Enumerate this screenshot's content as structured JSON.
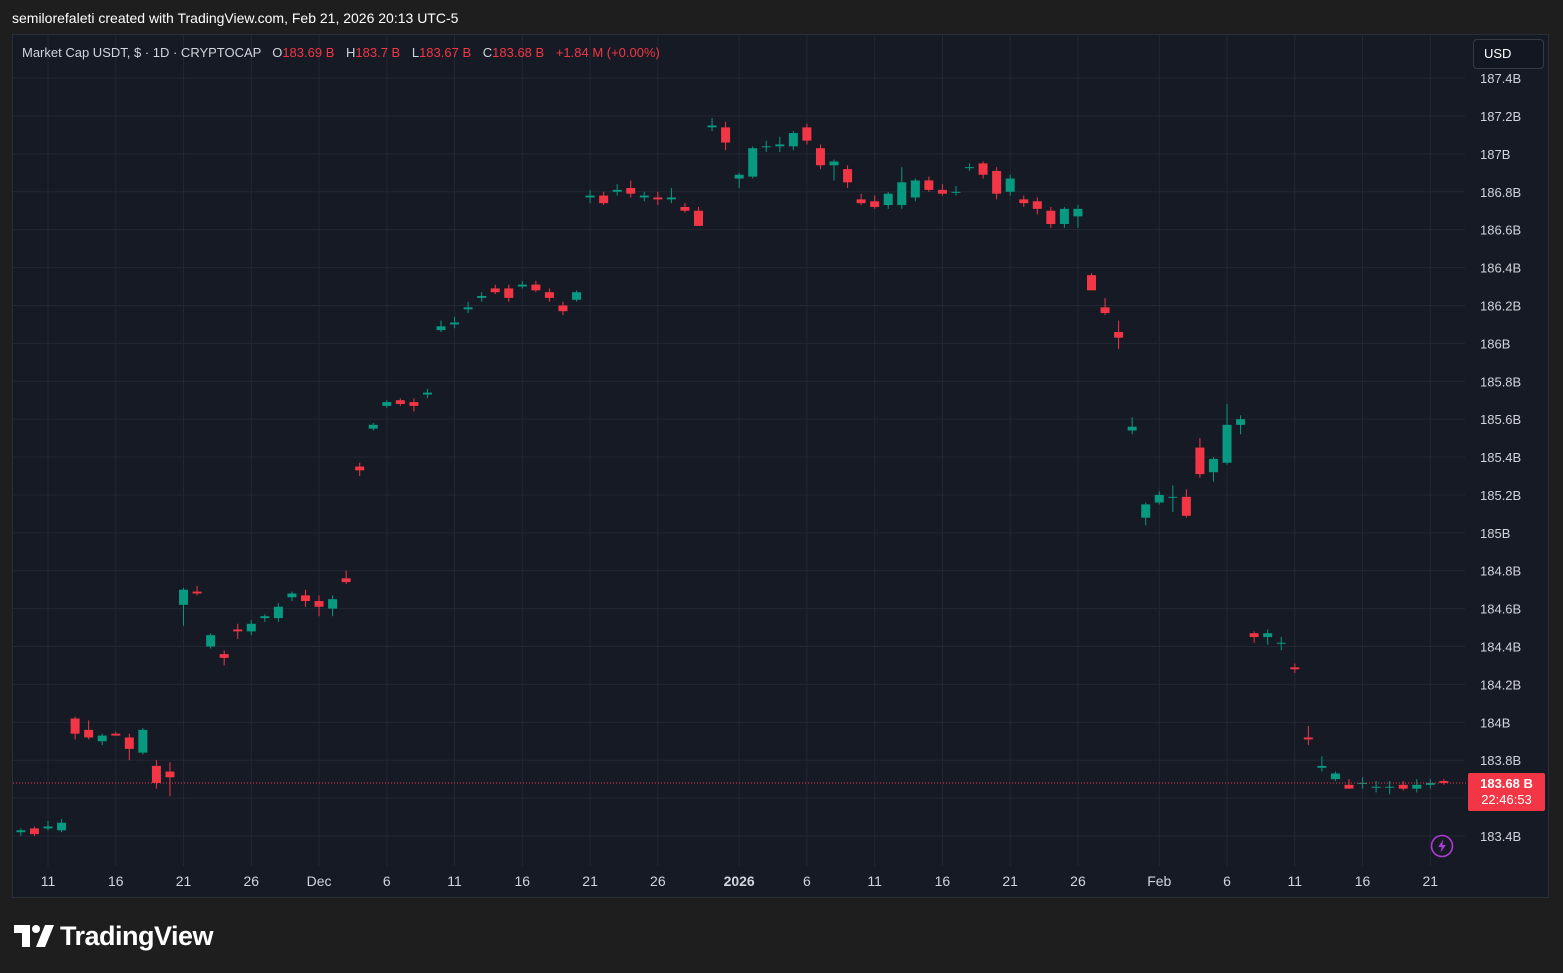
{
  "header": {
    "credit": "semilorefaleti created with TradingView.com, Feb 21, 2026 20:13 UTC-5"
  },
  "legend": {
    "symbol": "Market Cap USDT, $ · 1D · CRYPTOCAP",
    "o_label": "O",
    "o_value": "183.69 B",
    "h_label": "H",
    "h_value": "183.7 B",
    "l_label": "L",
    "l_value": "183.67 B",
    "c_label": "C",
    "c_value": "183.68 B",
    "change": "+1.84 M (+0.00%)"
  },
  "currency": "USD",
  "price_tag": {
    "price": "183.68 B",
    "countdown": "22:46:53"
  },
  "branding": {
    "logo_text": "TradingView"
  },
  "colors": {
    "up": "#089981",
    "down": "#f23645",
    "background": "#161a25",
    "grid": "#232733"
  },
  "chart_data": {
    "type": "candlestick",
    "y_unit": "B",
    "ylim": [
      183.3,
      187.45
    ],
    "y_ticks": [
      183.4,
      183.6,
      183.8,
      184.0,
      184.2,
      184.4,
      184.6,
      184.8,
      185.0,
      185.2,
      185.4,
      185.6,
      185.8,
      186.0,
      186.2,
      186.4,
      186.6,
      186.8,
      187.0,
      187.2,
      187.4
    ],
    "y_tick_labels": [
      "183.4B",
      "",
      "183.8B",
      "184B",
      "184.2B",
      "184.4B",
      "184.6B",
      "184.8B",
      "185B",
      "185.2B",
      "185.4B",
      "185.6B",
      "185.8B",
      "186B",
      "186.2B",
      "186.4B",
      "186.6B",
      "186.8B",
      "187B",
      "187.2B",
      "187.4B"
    ],
    "x_ticks": [
      {
        "date": "2025-11-11",
        "label": "11",
        "bold": false
      },
      {
        "date": "2025-11-16",
        "label": "16",
        "bold": false
      },
      {
        "date": "2025-11-21",
        "label": "21",
        "bold": false
      },
      {
        "date": "2025-11-26",
        "label": "26",
        "bold": false
      },
      {
        "date": "2025-12-01",
        "label": "Dec",
        "bold": false
      },
      {
        "date": "2025-12-06",
        "label": "6",
        "bold": false
      },
      {
        "date": "2025-12-11",
        "label": "11",
        "bold": false
      },
      {
        "date": "2025-12-16",
        "label": "16",
        "bold": false
      },
      {
        "date": "2025-12-21",
        "label": "21",
        "bold": false
      },
      {
        "date": "2025-12-26",
        "label": "26",
        "bold": false
      },
      {
        "date": "2026-01-01",
        "label": "2026",
        "bold": true
      },
      {
        "date": "2026-01-06",
        "label": "6",
        "bold": false
      },
      {
        "date": "2026-01-11",
        "label": "11",
        "bold": false
      },
      {
        "date": "2026-01-16",
        "label": "16",
        "bold": false
      },
      {
        "date": "2026-01-21",
        "label": "21",
        "bold": false
      },
      {
        "date": "2026-01-26",
        "label": "26",
        "bold": false
      },
      {
        "date": "2026-02-01",
        "label": "Feb",
        "bold": false
      },
      {
        "date": "2026-02-06",
        "label": "6",
        "bold": false
      },
      {
        "date": "2026-02-11",
        "label": "11",
        "bold": false
      },
      {
        "date": "2026-02-16",
        "label": "16",
        "bold": false
      },
      {
        "date": "2026-02-21",
        "label": "21",
        "bold": false
      }
    ],
    "last_price": 183.68,
    "candles": [
      {
        "date": "2025-11-09",
        "o": 183.42,
        "h": 183.44,
        "l": 183.4,
        "c": 183.43
      },
      {
        "date": "2025-11-10",
        "o": 183.44,
        "h": 183.45,
        "l": 183.4,
        "c": 183.41
      },
      {
        "date": "2025-11-11",
        "o": 183.44,
        "h": 183.48,
        "l": 183.43,
        "c": 183.45
      },
      {
        "date": "2025-11-12",
        "o": 183.43,
        "h": 183.49,
        "l": 183.42,
        "c": 183.47
      },
      {
        "date": "2025-11-13",
        "o": 184.02,
        "h": 184.03,
        "l": 183.91,
        "c": 183.94
      },
      {
        "date": "2025-11-14",
        "o": 183.96,
        "h": 184.01,
        "l": 183.91,
        "c": 183.92
      },
      {
        "date": "2025-11-15",
        "o": 183.9,
        "h": 183.94,
        "l": 183.88,
        "c": 183.93
      },
      {
        "date": "2025-11-16",
        "o": 183.94,
        "h": 183.95,
        "l": 183.93,
        "c": 183.93
      },
      {
        "date": "2025-11-17",
        "o": 183.92,
        "h": 183.94,
        "l": 183.8,
        "c": 183.86
      },
      {
        "date": "2025-11-18",
        "o": 183.84,
        "h": 183.97,
        "l": 183.83,
        "c": 183.96
      },
      {
        "date": "2025-11-19",
        "o": 183.77,
        "h": 183.8,
        "l": 183.65,
        "c": 183.68
      },
      {
        "date": "2025-11-20",
        "o": 183.74,
        "h": 183.79,
        "l": 183.61,
        "c": 183.71
      },
      {
        "date": "2025-11-21",
        "o": 184.62,
        "h": 184.71,
        "l": 184.51,
        "c": 184.7
      },
      {
        "date": "2025-11-22",
        "o": 184.69,
        "h": 184.72,
        "l": 184.67,
        "c": 184.68
      },
      {
        "date": "2025-11-23",
        "o": 184.4,
        "h": 184.47,
        "l": 184.39,
        "c": 184.46
      },
      {
        "date": "2025-11-24",
        "o": 184.36,
        "h": 184.38,
        "l": 184.3,
        "c": 184.34
      },
      {
        "date": "2025-11-25",
        "o": 184.49,
        "h": 184.52,
        "l": 184.44,
        "c": 184.48
      },
      {
        "date": "2025-11-26",
        "o": 184.48,
        "h": 184.54,
        "l": 184.46,
        "c": 184.52
      },
      {
        "date": "2025-11-27",
        "o": 184.55,
        "h": 184.57,
        "l": 184.53,
        "c": 184.56
      },
      {
        "date": "2025-11-28",
        "o": 184.55,
        "h": 184.63,
        "l": 184.53,
        "c": 184.61
      },
      {
        "date": "2025-11-29",
        "o": 184.66,
        "h": 184.69,
        "l": 184.64,
        "c": 184.68
      },
      {
        "date": "2025-11-30",
        "o": 184.67,
        "h": 184.7,
        "l": 184.61,
        "c": 184.64
      },
      {
        "date": "2025-12-01",
        "o": 184.64,
        "h": 184.67,
        "l": 184.56,
        "c": 184.61
      },
      {
        "date": "2025-12-02",
        "o": 184.6,
        "h": 184.67,
        "l": 184.56,
        "c": 184.65
      },
      {
        "date": "2025-12-03",
        "o": 184.76,
        "h": 184.8,
        "l": 184.73,
        "c": 184.74
      },
      {
        "date": "2025-12-04",
        "o": 185.35,
        "h": 185.37,
        "l": 185.3,
        "c": 185.33
      },
      {
        "date": "2025-12-05",
        "o": 185.55,
        "h": 185.58,
        "l": 185.54,
        "c": 185.57
      },
      {
        "date": "2025-12-06",
        "o": 185.67,
        "h": 185.7,
        "l": 185.66,
        "c": 185.69
      },
      {
        "date": "2025-12-07",
        "o": 185.7,
        "h": 185.71,
        "l": 185.67,
        "c": 185.68
      },
      {
        "date": "2025-12-08",
        "o": 185.69,
        "h": 185.71,
        "l": 185.64,
        "c": 185.67
      },
      {
        "date": "2025-12-09",
        "o": 185.73,
        "h": 185.76,
        "l": 185.71,
        "c": 185.74
      },
      {
        "date": "2025-12-10",
        "o": 186.07,
        "h": 186.12,
        "l": 186.06,
        "c": 186.09
      },
      {
        "date": "2025-12-11",
        "o": 186.1,
        "h": 186.14,
        "l": 186.08,
        "c": 186.11
      },
      {
        "date": "2025-12-12",
        "o": 186.18,
        "h": 186.22,
        "l": 186.16,
        "c": 186.19
      },
      {
        "date": "2025-12-13",
        "o": 186.24,
        "h": 186.27,
        "l": 186.22,
        "c": 186.25
      },
      {
        "date": "2025-12-14",
        "o": 186.29,
        "h": 186.31,
        "l": 186.26,
        "c": 186.27
      },
      {
        "date": "2025-12-15",
        "o": 186.29,
        "h": 186.31,
        "l": 186.22,
        "c": 186.24
      },
      {
        "date": "2025-12-16",
        "o": 186.3,
        "h": 186.33,
        "l": 186.29,
        "c": 186.31
      },
      {
        "date": "2025-12-17",
        "o": 186.31,
        "h": 186.33,
        "l": 186.27,
        "c": 186.28
      },
      {
        "date": "2025-12-18",
        "o": 186.27,
        "h": 186.29,
        "l": 186.22,
        "c": 186.24
      },
      {
        "date": "2025-12-19",
        "o": 186.2,
        "h": 186.22,
        "l": 186.15,
        "c": 186.17
      },
      {
        "date": "2025-12-20",
        "o": 186.23,
        "h": 186.28,
        "l": 186.22,
        "c": 186.27
      },
      {
        "date": "2025-12-21",
        "o": 186.77,
        "h": 186.81,
        "l": 186.74,
        "c": 186.78
      },
      {
        "date": "2025-12-22",
        "o": 186.78,
        "h": 186.8,
        "l": 186.73,
        "c": 186.74
      },
      {
        "date": "2025-12-23",
        "o": 186.8,
        "h": 186.84,
        "l": 186.78,
        "c": 186.81
      },
      {
        "date": "2025-12-24",
        "o": 186.82,
        "h": 186.86,
        "l": 186.77,
        "c": 186.79
      },
      {
        "date": "2025-12-25",
        "o": 186.77,
        "h": 186.8,
        "l": 186.75,
        "c": 186.78
      },
      {
        "date": "2025-12-26",
        "o": 186.77,
        "h": 186.8,
        "l": 186.73,
        "c": 186.76
      },
      {
        "date": "2025-12-27",
        "o": 186.76,
        "h": 186.82,
        "l": 186.74,
        "c": 186.77
      },
      {
        "date": "2025-12-28",
        "o": 186.72,
        "h": 186.74,
        "l": 186.69,
        "c": 186.7
      },
      {
        "date": "2025-12-29",
        "o": 186.7,
        "h": 186.72,
        "l": 186.62,
        "c": 186.62
      },
      {
        "date": "2025-12-30",
        "o": 187.14,
        "h": 187.19,
        "l": 187.12,
        "c": 187.15
      },
      {
        "date": "2025-12-31",
        "o": 187.14,
        "h": 187.17,
        "l": 187.02,
        "c": 187.06
      },
      {
        "date": "2026-01-01",
        "o": 186.87,
        "h": 186.9,
        "l": 186.82,
        "c": 186.89
      },
      {
        "date": "2026-01-02",
        "o": 186.88,
        "h": 187.04,
        "l": 186.87,
        "c": 187.03
      },
      {
        "date": "2026-01-03",
        "o": 187.04,
        "h": 187.07,
        "l": 187.01,
        "c": 187.04
      },
      {
        "date": "2026-01-04",
        "o": 187.04,
        "h": 187.09,
        "l": 187.01,
        "c": 187.05
      },
      {
        "date": "2026-01-05",
        "o": 187.04,
        "h": 187.12,
        "l": 187.02,
        "c": 187.11
      },
      {
        "date": "2026-01-06",
        "o": 187.14,
        "h": 187.16,
        "l": 187.05,
        "c": 187.07
      },
      {
        "date": "2026-01-07",
        "o": 187.03,
        "h": 187.05,
        "l": 186.92,
        "c": 186.94
      },
      {
        "date": "2026-01-08",
        "o": 186.94,
        "h": 186.97,
        "l": 186.86,
        "c": 186.96
      },
      {
        "date": "2026-01-09",
        "o": 186.92,
        "h": 186.94,
        "l": 186.82,
        "c": 186.85
      },
      {
        "date": "2026-01-10",
        "o": 186.76,
        "h": 186.79,
        "l": 186.73,
        "c": 186.74
      },
      {
        "date": "2026-01-11",
        "o": 186.75,
        "h": 186.78,
        "l": 186.71,
        "c": 186.72
      },
      {
        "date": "2026-01-12",
        "o": 186.73,
        "h": 186.8,
        "l": 186.71,
        "c": 186.79
      },
      {
        "date": "2026-01-13",
        "o": 186.73,
        "h": 186.93,
        "l": 186.71,
        "c": 186.85
      },
      {
        "date": "2026-01-14",
        "o": 186.77,
        "h": 186.87,
        "l": 186.75,
        "c": 186.86
      },
      {
        "date": "2026-01-15",
        "o": 186.86,
        "h": 186.88,
        "l": 186.8,
        "c": 186.81
      },
      {
        "date": "2026-01-16",
        "o": 186.81,
        "h": 186.84,
        "l": 186.78,
        "c": 186.79
      },
      {
        "date": "2026-01-17",
        "o": 186.8,
        "h": 186.83,
        "l": 186.78,
        "c": 186.8
      },
      {
        "date": "2026-01-18",
        "o": 186.93,
        "h": 186.95,
        "l": 186.91,
        "c": 186.93
      },
      {
        "date": "2026-01-19",
        "o": 186.95,
        "h": 186.96,
        "l": 186.87,
        "c": 186.89
      },
      {
        "date": "2026-01-20",
        "o": 186.91,
        "h": 186.93,
        "l": 186.76,
        "c": 186.79
      },
      {
        "date": "2026-01-21",
        "o": 186.8,
        "h": 186.89,
        "l": 186.78,
        "c": 186.87
      },
      {
        "date": "2026-01-22",
        "o": 186.76,
        "h": 186.78,
        "l": 186.72,
        "c": 186.74
      },
      {
        "date": "2026-01-23",
        "o": 186.75,
        "h": 186.77,
        "l": 186.68,
        "c": 186.71
      },
      {
        "date": "2026-01-24",
        "o": 186.7,
        "h": 186.72,
        "l": 186.61,
        "c": 186.63
      },
      {
        "date": "2026-01-25",
        "o": 186.63,
        "h": 186.72,
        "l": 186.61,
        "c": 186.71
      },
      {
        "date": "2026-01-26",
        "o": 186.67,
        "h": 186.73,
        "l": 186.61,
        "c": 186.71
      },
      {
        "date": "2026-01-27",
        "o": 186.36,
        "h": 186.37,
        "l": 186.28,
        "c": 186.28
      },
      {
        "date": "2026-01-28",
        "o": 186.19,
        "h": 186.24,
        "l": 186.15,
        "c": 186.16
      },
      {
        "date": "2026-01-29",
        "o": 186.06,
        "h": 186.12,
        "l": 185.97,
        "c": 186.03
      },
      {
        "date": "2026-01-30",
        "o": 185.54,
        "h": 185.61,
        "l": 185.52,
        "c": 185.56
      },
      {
        "date": "2026-01-31",
        "o": 185.08,
        "h": 185.16,
        "l": 185.04,
        "c": 185.15
      },
      {
        "date": "2026-02-01",
        "o": 185.16,
        "h": 185.22,
        "l": 185.15,
        "c": 185.2
      },
      {
        "date": "2026-02-02",
        "o": 185.19,
        "h": 185.25,
        "l": 185.11,
        "c": 185.19
      },
      {
        "date": "2026-02-03",
        "o": 185.19,
        "h": 185.23,
        "l": 185.08,
        "c": 185.09
      },
      {
        "date": "2026-02-04",
        "o": 185.45,
        "h": 185.5,
        "l": 185.29,
        "c": 185.31
      },
      {
        "date": "2026-02-05",
        "o": 185.32,
        "h": 185.4,
        "l": 185.27,
        "c": 185.39
      },
      {
        "date": "2026-02-06",
        "o": 185.37,
        "h": 185.68,
        "l": 185.36,
        "c": 185.57
      },
      {
        "date": "2026-02-07",
        "o": 185.57,
        "h": 185.62,
        "l": 185.52,
        "c": 185.6
      },
      {
        "date": "2026-02-08",
        "o": 184.47,
        "h": 184.48,
        "l": 184.42,
        "c": 184.45
      },
      {
        "date": "2026-02-09",
        "o": 184.45,
        "h": 184.49,
        "l": 184.41,
        "c": 184.47
      },
      {
        "date": "2026-02-10",
        "o": 184.42,
        "h": 184.45,
        "l": 184.38,
        "c": 184.42
      },
      {
        "date": "2026-02-11",
        "o": 184.29,
        "h": 184.31,
        "l": 184.26,
        "c": 184.28
      },
      {
        "date": "2026-02-12",
        "o": 183.92,
        "h": 183.98,
        "l": 183.88,
        "c": 183.91
      },
      {
        "date": "2026-02-13",
        "o": 183.76,
        "h": 183.82,
        "l": 183.74,
        "c": 183.77
      },
      {
        "date": "2026-02-14",
        "o": 183.7,
        "h": 183.74,
        "l": 183.69,
        "c": 183.73
      },
      {
        "date": "2026-02-15",
        "o": 183.67,
        "h": 183.7,
        "l": 183.65,
        "c": 183.65
      },
      {
        "date": "2026-02-16",
        "o": 183.68,
        "h": 183.71,
        "l": 183.65,
        "c": 183.68
      },
      {
        "date": "2026-02-17",
        "o": 183.66,
        "h": 183.69,
        "l": 183.63,
        "c": 183.66
      },
      {
        "date": "2026-02-18",
        "o": 183.66,
        "h": 183.69,
        "l": 183.62,
        "c": 183.66
      },
      {
        "date": "2026-02-19",
        "o": 183.67,
        "h": 183.69,
        "l": 183.64,
        "c": 183.65
      },
      {
        "date": "2026-02-20",
        "o": 183.65,
        "h": 183.7,
        "l": 183.63,
        "c": 183.67
      },
      {
        "date": "2026-02-21",
        "o": 183.67,
        "h": 183.7,
        "l": 183.65,
        "c": 183.68
      },
      {
        "date": "2026-02-22",
        "o": 183.69,
        "h": 183.7,
        "l": 183.67,
        "c": 183.68
      }
    ]
  }
}
